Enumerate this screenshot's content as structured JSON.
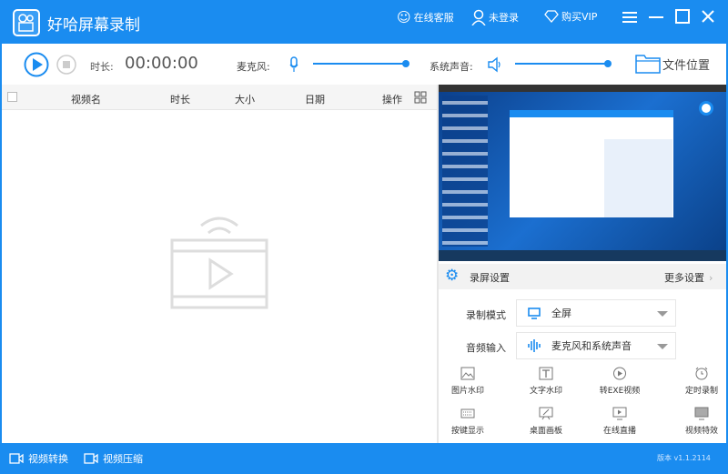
{
  "app": {
    "title": "好哈屏幕录制",
    "version": "版本 v1.1.2114"
  },
  "titlebar": {
    "service": "在线客服",
    "login": "未登录",
    "vip": "购买VIP"
  },
  "toolbar": {
    "duration_label": "时长:",
    "duration": "00:00:00",
    "mic_label": "麦克风:",
    "mic_level": 1.0,
    "sys_label": "系统声音:",
    "sys_level": 1.0,
    "file_location": "文件位置"
  },
  "list": {
    "columns": [
      "视频名",
      "时长",
      "大小",
      "日期",
      "操作"
    ],
    "rows": []
  },
  "settings": {
    "title": "录屏设置",
    "more": "更多设置",
    "mode_label": "录制模式",
    "mode_value": "全屏",
    "audio_label": "音频输入",
    "audio_value": "麦克风和系统声音",
    "tools": [
      "图片水印",
      "文字水印",
      "转EXE视频",
      "定时录制",
      "按键显示",
      "桌面画板",
      "在线直播",
      "视频特效"
    ]
  },
  "bottom": {
    "convert": "视频转换",
    "compress": "视频压缩"
  },
  "colors": {
    "accent": "#1a8cf0"
  }
}
